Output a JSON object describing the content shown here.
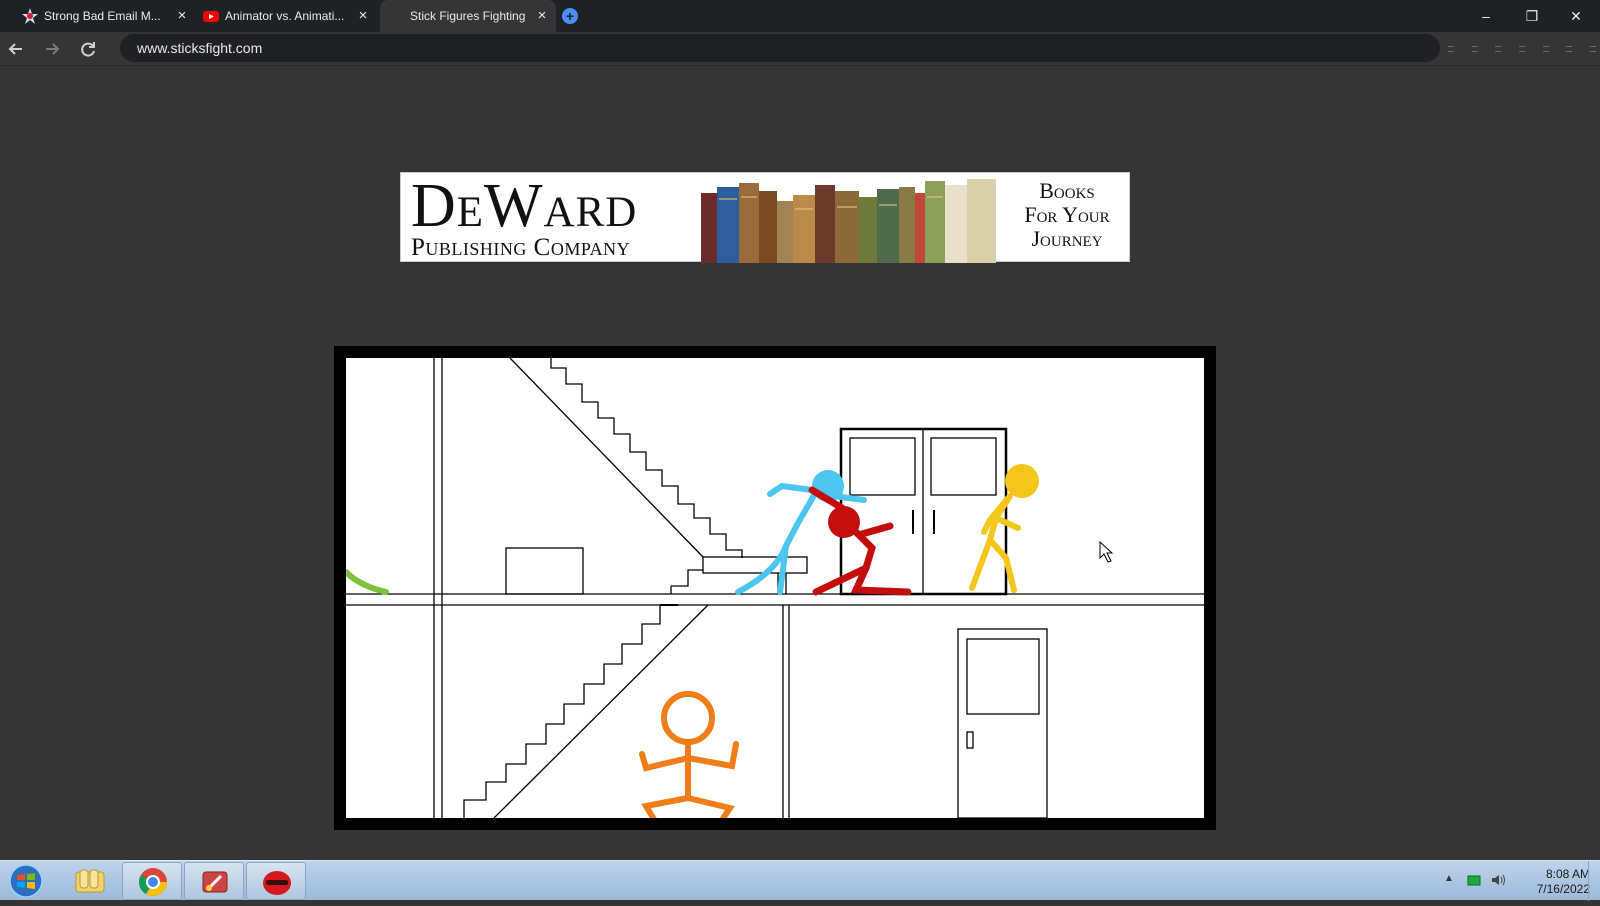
{
  "browser": {
    "tabs": [
      {
        "title": "Strong Bad Email M...",
        "favicon": "homestar-icon"
      },
      {
        "title": "Animator vs. Animati...",
        "favicon": "youtube-icon"
      },
      {
        "title": "Stick Figures Fighting",
        "favicon": "none",
        "active": true
      }
    ],
    "new_tab_label": "+",
    "url": "www.sticksfight.com",
    "controls": {
      "minimize": "–",
      "restore": "❐",
      "close": "✕"
    }
  },
  "ad": {
    "brand_name": "DeWard",
    "brand_sub": "Publishing Company",
    "tagline_line1": "Books",
    "tagline_line2": "For Your",
    "tagline_line3": "Journey"
  },
  "game": {
    "fighters": [
      {
        "color": "#4cc6ef",
        "name": "blue-stick-figure"
      },
      {
        "color": "#c40e0e",
        "name": "red-stick-figure"
      },
      {
        "color": "#f4c51a",
        "name": "yellow-stick-figure"
      },
      {
        "color": "#f07d17",
        "name": "orange-stick-figure"
      },
      {
        "color": "#7cc23a",
        "name": "green-stick-figure"
      }
    ]
  },
  "taskbar": {
    "apps": [
      "windows-explorer-icon",
      "chrome-icon",
      "flash-animation-icon",
      "red-hood-icon"
    ],
    "clock_time": "8:08 AM",
    "clock_date": "7/16/2022"
  }
}
